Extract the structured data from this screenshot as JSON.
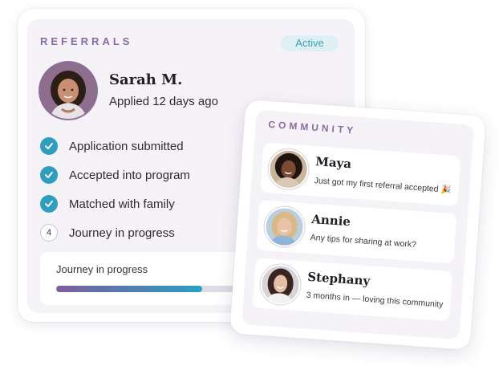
{
  "referrals": {
    "heading": "REFERRALS",
    "status": "Active",
    "applicant": {
      "name": "Sarah M.",
      "subtitle": "Applied 12 days ago"
    },
    "steps": [
      {
        "label": "Application submitted",
        "state": "done",
        "icon": "check-icon"
      },
      {
        "label": "Accepted into program",
        "state": "done",
        "icon": "check-icon"
      },
      {
        "label": "Matched with family",
        "state": "done",
        "icon": "check-icon"
      },
      {
        "label": "Journey in progress",
        "state": "current",
        "number": "4"
      }
    ],
    "progress": {
      "label": "Journey in progress",
      "fraction": 0.76
    }
  },
  "community": {
    "heading": "COMMUNITY",
    "posts": [
      {
        "name": "Maya",
        "text": "Just got my first referral accepted 🎉"
      },
      {
        "name": "Annie",
        "text": "Any tips for sharing at work?"
      },
      {
        "name": "Stephany",
        "text": "3 months in — loving this community"
      }
    ]
  },
  "colors": {
    "accent_purple": "#8a6aa2",
    "accent_teal": "#2f9dbd",
    "panel_bg": "#f6f3f8",
    "pill_bg": "#dff0f4"
  }
}
